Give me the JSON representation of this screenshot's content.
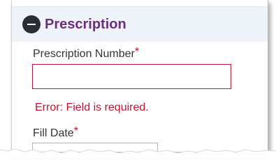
{
  "section": {
    "title": "Prescription",
    "collapse_icon": "minus-circle-icon"
  },
  "fields": {
    "prescription_number": {
      "label": "Prescription Number",
      "required_marker": "*",
      "value": "",
      "error": "Error: Field is required."
    },
    "fill_date": {
      "label": "Fill Date",
      "required_marker": "*",
      "value": ""
    }
  },
  "colors": {
    "title": "#6b2f7e",
    "error": "#c8102e",
    "header_background": "#eef3fa",
    "icon": "#2c2c33"
  }
}
